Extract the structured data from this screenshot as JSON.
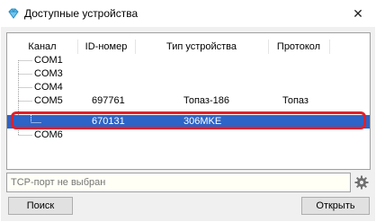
{
  "window": {
    "title": "Доступные устройства",
    "close_symbol": "✕",
    "icon": "diamond-icon"
  },
  "table": {
    "columns": [
      "Канал",
      "ID-номер",
      "Тип устройства",
      "Протокол"
    ],
    "rows": [
      {
        "channel": "COM1",
        "id": "",
        "type": "",
        "protocol": ""
      },
      {
        "channel": "COM3",
        "id": "",
        "type": "",
        "protocol": ""
      },
      {
        "channel": "COM4",
        "id": "",
        "type": "",
        "protocol": ""
      },
      {
        "channel": "COM5",
        "id": "697761",
        "type": "Топаз-186",
        "protocol": "Топаз"
      },
      {
        "channel": "",
        "id": "670131",
        "type": "306MKE",
        "protocol": ""
      },
      {
        "channel": "COM6",
        "id": "",
        "type": "",
        "protocol": ""
      }
    ],
    "selected_row": 4,
    "highlight_color": "#e0202a",
    "selection_color": "#2c64c8"
  },
  "tcp": {
    "placeholder": "TCP-порт не выбран",
    "settings_icon": "gear-icon"
  },
  "buttons": {
    "search": "Поиск",
    "open": "Открыть"
  }
}
